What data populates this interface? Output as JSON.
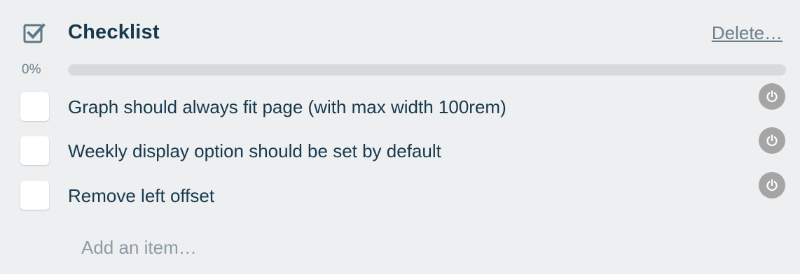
{
  "checklist": {
    "title": "Checklist",
    "icon": "checkbox-checked-icon",
    "delete_label": "Delete…",
    "progress": {
      "label": "0%",
      "fraction": 0,
      "fill_color": "#5aac44"
    },
    "items": [
      {
        "label": "Graph should always fit page (with max width 100rem)",
        "checked": false,
        "action_icon": "power-icon"
      },
      {
        "label": "Weekly display option should be set by default",
        "checked": false,
        "action_icon": "power-icon"
      },
      {
        "label": "Remove left offset",
        "checked": false,
        "action_icon": "power-icon"
      }
    ],
    "add_item_label": "Add an item…"
  },
  "colors": {
    "background": "#edeff1",
    "title_text": "#17394d",
    "muted_text": "#6b808c",
    "progress_track": "#d6dadc",
    "icon_button": "#a5a5a5"
  }
}
